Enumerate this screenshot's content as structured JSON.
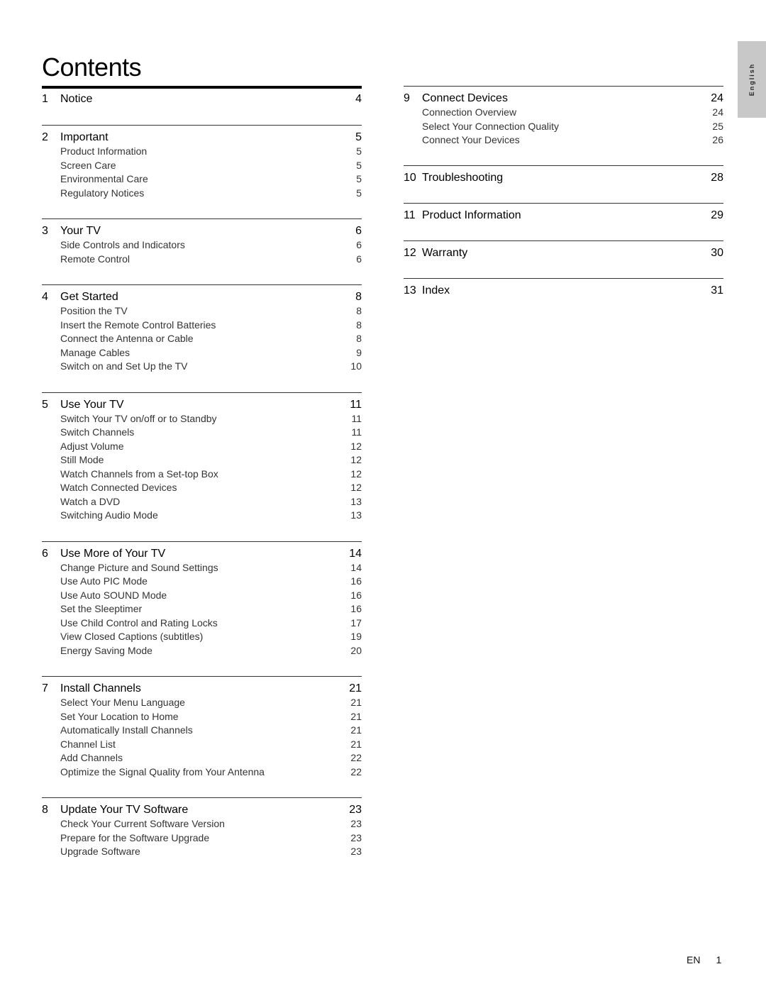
{
  "title": "Contents",
  "side_tab": "English",
  "footer": {
    "lang": "EN",
    "page": "1"
  },
  "left_sections": [
    {
      "num": "1",
      "title": "Notice",
      "page": "4",
      "items": []
    },
    {
      "num": "2",
      "title": "Important",
      "page": "5",
      "items": [
        {
          "label": "Product Information",
          "page": "5"
        },
        {
          "label": "Screen Care",
          "page": "5"
        },
        {
          "label": "Environmental Care",
          "page": "5"
        },
        {
          "label": "Regulatory Notices",
          "page": "5"
        }
      ]
    },
    {
      "num": "3",
      "title": "Your TV",
      "page": "6",
      "items": [
        {
          "label": "Side Controls and Indicators",
          "page": "6"
        },
        {
          "label": "Remote Control",
          "page": "6"
        }
      ]
    },
    {
      "num": "4",
      "title": "Get Started",
      "page": "8",
      "items": [
        {
          "label": "Position the TV",
          "page": "8"
        },
        {
          "label": "Insert the Remote Control Batteries",
          "page": "8"
        },
        {
          "label": "Connect the Antenna or Cable",
          "page": "8"
        },
        {
          "label": "Manage Cables",
          "page": "9"
        },
        {
          "label": "Switch on and Set Up the TV",
          "page": "10"
        }
      ]
    },
    {
      "num": "5",
      "title": "Use Your TV",
      "page": "11",
      "items": [
        {
          "label": "Switch Your TV on/off or to Standby",
          "page": "11"
        },
        {
          "label": "Switch Channels",
          "page": "11"
        },
        {
          "label": "Adjust Volume",
          "page": "12"
        },
        {
          "label": "Still Mode",
          "page": "12"
        },
        {
          "label": "Watch Channels from a Set-top Box",
          "page": "12"
        },
        {
          "label": "Watch Connected Devices",
          "page": "12"
        },
        {
          "label": "Watch a DVD",
          "page": "13"
        },
        {
          "label": "Switching Audio Mode",
          "page": "13"
        }
      ]
    },
    {
      "num": "6",
      "title": "Use More of Your TV",
      "page": "14",
      "items": [
        {
          "label": "Change Picture and Sound Settings",
          "page": "14"
        },
        {
          "label": "Use Auto PIC Mode",
          "page": "16"
        },
        {
          "label": "Use Auto SOUND Mode",
          "page": "16"
        },
        {
          "label": "Set the Sleeptimer",
          "page": "16"
        },
        {
          "label": "Use Child Control and Rating Locks",
          "page": "17"
        },
        {
          "label": "View Closed Captions (subtitles)",
          "page": "19"
        },
        {
          "label": "Energy Saving Mode",
          "page": "20"
        }
      ]
    },
    {
      "num": "7",
      "title": "Install Channels",
      "page": "21",
      "items": [
        {
          "label": "Select Your Menu Language",
          "page": "21"
        },
        {
          "label": "Set Your Location to Home",
          "page": "21"
        },
        {
          "label": "Automatically Install Channels",
          "page": "21"
        },
        {
          "label": "Channel List",
          "page": "21"
        },
        {
          "label": "Add Channels",
          "page": "22"
        },
        {
          "label": "Optimize the Signal Quality from Your Antenna",
          "page": "22"
        }
      ]
    },
    {
      "num": "8",
      "title": "Update Your TV Software",
      "page": "23",
      "items": [
        {
          "label": "Check Your Current Software Version",
          "page": "23"
        },
        {
          "label": "Prepare for the Software Upgrade",
          "page": "23"
        },
        {
          "label": "Upgrade Software",
          "page": "23"
        }
      ]
    }
  ],
  "right_sections": [
    {
      "num": "9",
      "title": "Connect Devices",
      "page": "24",
      "items": [
        {
          "label": "Connection Overview",
          "page": "24"
        },
        {
          "label": "Select Your Connection Quality",
          "page": "25"
        },
        {
          "label": "Connect Your Devices",
          "page": "26"
        }
      ]
    },
    {
      "num": "10",
      "title": "Troubleshooting",
      "page": "28",
      "items": []
    },
    {
      "num": "11",
      "title": "Product Information",
      "page": "29",
      "items": []
    },
    {
      "num": "12",
      "title": "Warranty",
      "page": "30",
      "items": []
    },
    {
      "num": "13",
      "title": "Index",
      "page": "31",
      "items": []
    }
  ]
}
